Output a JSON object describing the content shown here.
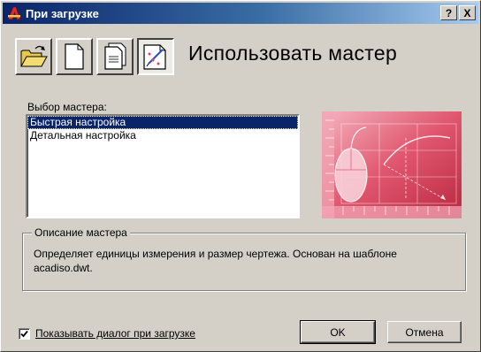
{
  "window": {
    "title": "При загрузке",
    "help_button": "?",
    "close_button": "X"
  },
  "toolbar": {
    "tools": [
      {
        "icon": "open-folder-icon"
      },
      {
        "icon": "blank-document-icon"
      },
      {
        "icon": "template-document-icon"
      },
      {
        "icon": "wizard-icon",
        "pressed": true
      }
    ],
    "heading": "Использовать мастер"
  },
  "wizard_list": {
    "label": "Выбор мастера:",
    "items": [
      {
        "label": "Быстрая настройка",
        "selected": true
      },
      {
        "label": "Детальная настройка",
        "selected": false
      }
    ]
  },
  "description": {
    "title": "Описание мастера",
    "text": "Определяет единицы измерения и размер чертежа. Основан на шаблоне acadiso.dwt."
  },
  "footer": {
    "show_dialog_label": "Показывать диалог при загрузке",
    "show_dialog_checked": true,
    "ok_label": "OK",
    "cancel_label": "Отмена"
  },
  "colors": {
    "title_gradient_start": "#0a246a",
    "title_gradient_end": "#a6caf0",
    "selection": "#0a246a",
    "preview_red": "#d9435b"
  }
}
